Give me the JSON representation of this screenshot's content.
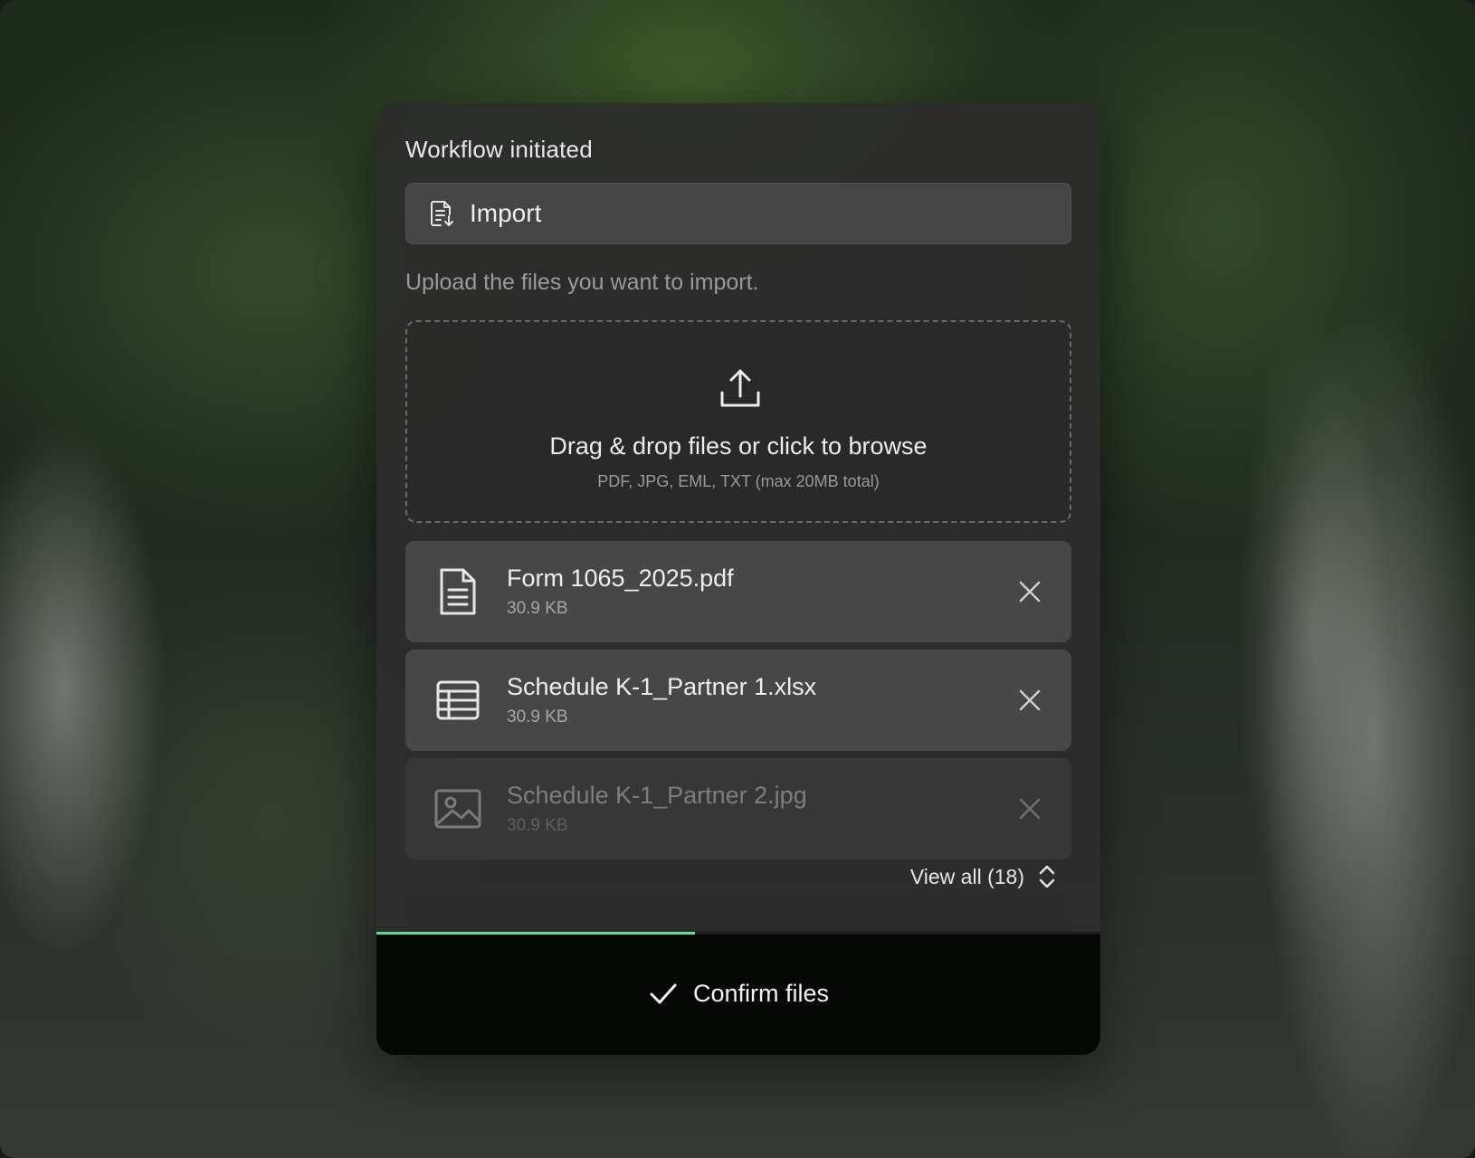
{
  "modal": {
    "title": "Workflow initiated",
    "step": {
      "label": "Import",
      "icon": "document-import-icon"
    },
    "helper_text": "Upload the files you want to import.",
    "dropzone": {
      "icon": "upload-icon",
      "title": "Drag & drop files or click to browse",
      "subtitle": "PDF, JPG, EML, TXT (max 20MB total)"
    },
    "files": [
      {
        "name": "Form 1065_2025.pdf",
        "size": "30.9 KB",
        "icon": "document-icon"
      },
      {
        "name": "Schedule K-1_Partner 1.xlsx",
        "size": "30.9 KB",
        "icon": "spreadsheet-icon"
      },
      {
        "name": "Schedule K-1_Partner 2.jpg",
        "size": "30.9 KB",
        "icon": "image-icon"
      }
    ],
    "view_all_label": "View all (18)",
    "progress": 0.44,
    "confirm_label": "Confirm files"
  },
  "colors": {
    "progress": "#6fd39a",
    "footer": "#060806",
    "card": "#2c2c2c",
    "row": "#474747"
  }
}
